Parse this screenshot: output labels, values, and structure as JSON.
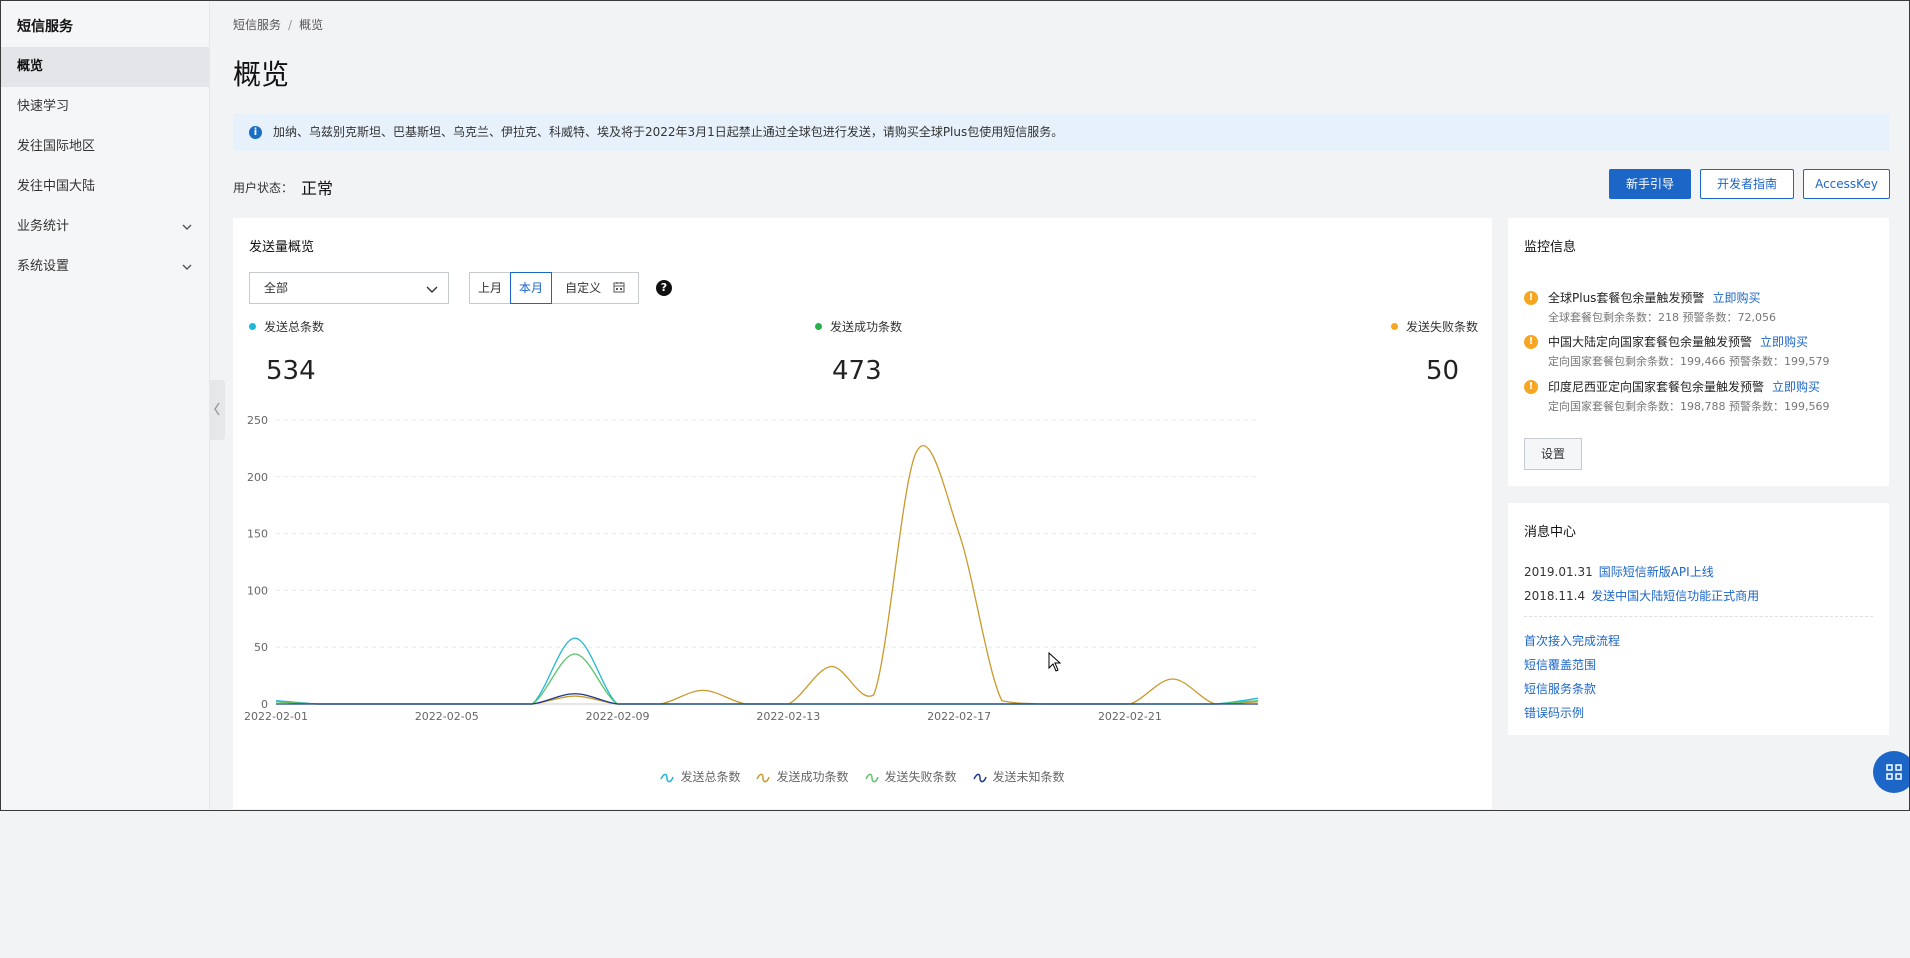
{
  "sidebar": {
    "title": "短信服务",
    "items": [
      {
        "label": "概览"
      },
      {
        "label": "快速学习"
      },
      {
        "label": "发往国际地区"
      },
      {
        "label": "发往中国大陆"
      },
      {
        "label": "业务统计"
      },
      {
        "label": "系统设置"
      }
    ]
  },
  "breadcrumb": {
    "root": "短信服务",
    "separator": "/",
    "current": "概览"
  },
  "page_title": "概览",
  "notice": {
    "text": "加纳、乌兹别克斯坦、巴基斯坦、乌克兰、伊拉克、科威特、埃及将于2022年3月1日起禁止通过全球包进行发送，请购买全球Plus包使用短信服务。"
  },
  "user_status": {
    "label": "用户状态：",
    "value": "正常"
  },
  "actions": {
    "guide": "新手引导",
    "dev_guide": "开发者指南",
    "access_key": "AccessKey"
  },
  "overview": {
    "title": "发送量概览",
    "filter": {
      "selected": "全部"
    },
    "period": {
      "last_month": "上月",
      "this_month": "本月",
      "custom": "自定义"
    },
    "help": "?",
    "stats": [
      {
        "label": "发送总条数",
        "value": "534",
        "color": "#1fb6d8"
      },
      {
        "label": "发送成功条数",
        "value": "473",
        "color": "#27b14a"
      },
      {
        "label": "发送失败条数",
        "value": "50",
        "color": "#f5a623"
      }
    ]
  },
  "chart_data": {
    "type": "line",
    "x": [
      "2022-02-01",
      "2022-02-02",
      "2022-02-03",
      "2022-02-04",
      "2022-02-05",
      "2022-02-06",
      "2022-02-07",
      "2022-02-08",
      "2022-02-09",
      "2022-02-10",
      "2022-02-11",
      "2022-02-12",
      "2022-02-13",
      "2022-02-14",
      "2022-02-15",
      "2022-02-16",
      "2022-02-17",
      "2022-02-18",
      "2022-02-19",
      "2022-02-20",
      "2022-02-21",
      "2022-02-22",
      "2022-02-23",
      "2022-02-24"
    ],
    "xticks": [
      "2022-02-01",
      "2022-02-05",
      "2022-02-09",
      "2022-02-13",
      "2022-02-17",
      "2022-02-21"
    ],
    "ylim": [
      0,
      250
    ],
    "yticks": [
      0,
      50,
      100,
      150,
      200,
      250
    ],
    "grid": true,
    "legend_position": "bottom",
    "series": [
      {
        "name": "发送总条数",
        "color": "#1fb6d8",
        "values": [
          3,
          0,
          0,
          0,
          0,
          0,
          0,
          58,
          0,
          0,
          0,
          0,
          0,
          0,
          0,
          0,
          0,
          0,
          0,
          0,
          0,
          0,
          0,
          5
        ]
      },
      {
        "name": "发送成功条数",
        "color": "#c99a2e",
        "values": [
          2,
          0,
          0,
          0,
          0,
          0,
          0,
          7,
          0,
          0,
          12,
          0,
          0,
          33,
          8,
          222,
          150,
          3,
          0,
          0,
          0,
          22,
          0,
          2
        ]
      },
      {
        "name": "发送失败条数",
        "color": "#5cc46a",
        "values": [
          2,
          0,
          0,
          0,
          0,
          0,
          0,
          44,
          0,
          0,
          0,
          0,
          0,
          0,
          0,
          0,
          0,
          0,
          0,
          0,
          0,
          0,
          0,
          3
        ]
      },
      {
        "name": "发送未知条数",
        "color": "#1d3a8a",
        "values": [
          0,
          0,
          0,
          0,
          0,
          0,
          0,
          9,
          0,
          0,
          0,
          0,
          0,
          0,
          0,
          0,
          0,
          0,
          0,
          0,
          0,
          0,
          0,
          0
        ]
      }
    ]
  },
  "monitor": {
    "title": "监控信息",
    "alerts": [
      {
        "title": "全球Plus套餐包余量触发预警",
        "link": "立即购买",
        "detail": "全球套餐包剩余条数：218   预警条数：72,056"
      },
      {
        "title": "中国大陆定向国家套餐包余量触发预警",
        "link": "立即购买",
        "detail": "定向国家套餐包剩余条数：199,466   预警条数：199,579"
      },
      {
        "title": "印度尼西亚定向国家套餐包余量触发预警",
        "link": "立即购买",
        "detail": "定向国家套餐包剩余条数：198,788   预警条数：199,569"
      }
    ],
    "settings": "设置"
  },
  "messages": {
    "title": "消息中心",
    "news": [
      {
        "date": "2019.01.31",
        "text": "国际短信新版API上线"
      },
      {
        "date": "2018.11.4",
        "text": "发送中国大陆短信功能正式商用"
      }
    ],
    "links": [
      "首次接入完成流程",
      "短信覆盖范围",
      "短信服务条款",
      "错误码示例"
    ]
  }
}
